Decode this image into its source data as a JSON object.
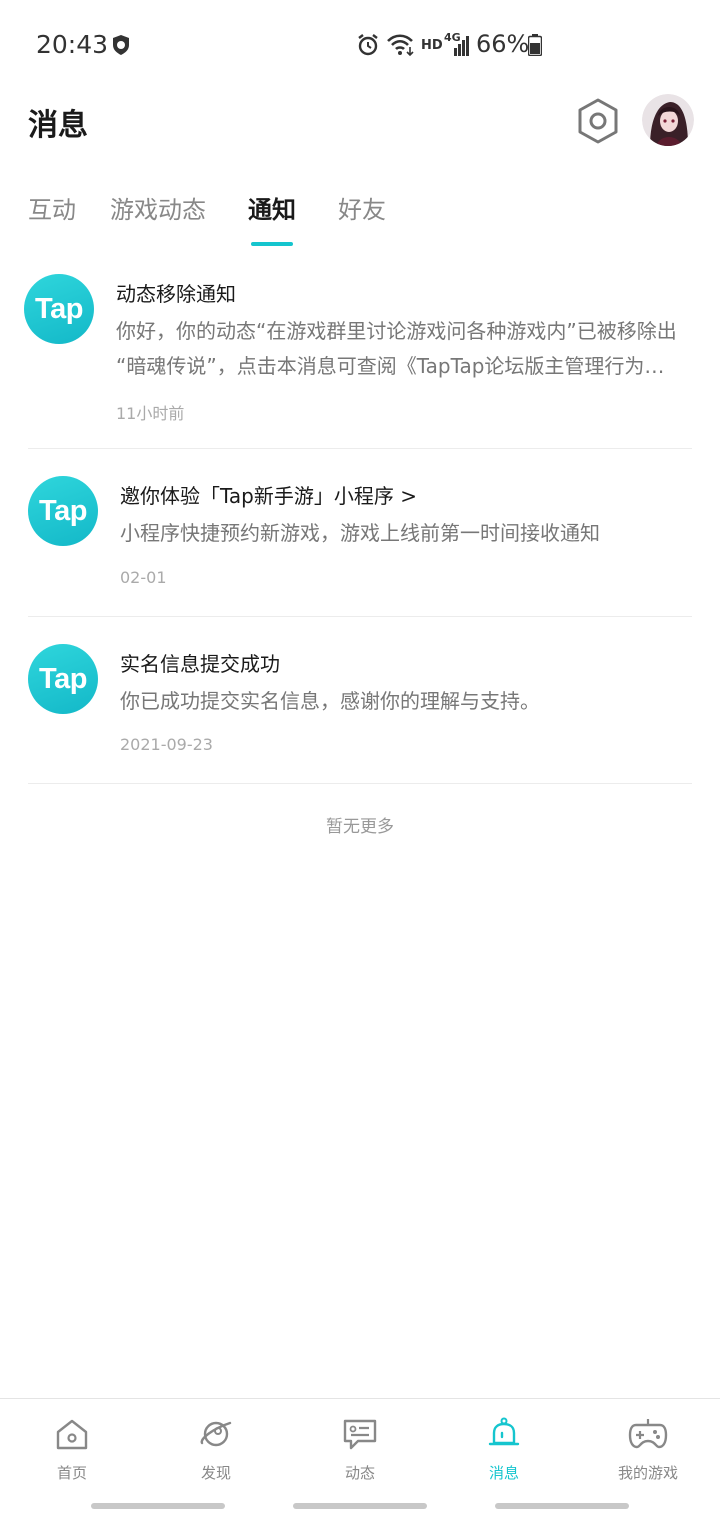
{
  "status_bar": {
    "time": "20:43",
    "network_label": "HD",
    "network_type": "4G",
    "battery": "66%"
  },
  "header": {
    "title": "消息",
    "settings_icon": "hexagon-settings-icon",
    "avatar_icon": "user-avatar"
  },
  "tabs": [
    {
      "label": "互动",
      "active": false
    },
    {
      "label": "游戏动态",
      "active": false
    },
    {
      "label": "通知",
      "active": true
    },
    {
      "label": "好友",
      "active": false
    }
  ],
  "notifications": [
    {
      "logo_text": "Tap",
      "title": "动态移除通知",
      "body_line1": "你好，你的动态“在游戏群里讨论游戏问各种游戏内”已被移除出",
      "body_line2": "“暗魂传说”，点击本消息可查阅《TapTap论坛版主管理行为…",
      "time": "11小时前"
    },
    {
      "logo_text": "Tap",
      "title": "邀你体验「Tap新手游」小程序 >",
      "body_line1": "小程序快捷预约新游戏，游戏上线前第一时间接收通知",
      "time": "02-01"
    },
    {
      "logo_text": "Tap",
      "title": "实名信息提交成功",
      "body_line1": "你已成功提交实名信息，感谢你的理解与支持。",
      "time": "2021-09-23"
    }
  ],
  "no_more_text": "暂无更多",
  "bottom_nav": [
    {
      "label": "首页",
      "icon": "home-icon",
      "active": false
    },
    {
      "label": "发现",
      "icon": "planet-icon",
      "active": false
    },
    {
      "label": "动态",
      "icon": "chat-bubble-icon",
      "active": false
    },
    {
      "label": "消息",
      "icon": "bell-icon",
      "active": true
    },
    {
      "label": "我的游戏",
      "icon": "gamepad-icon",
      "active": false
    }
  ],
  "colors": {
    "accent": "#15c5ce",
    "tap_logo": "#1bc2d0"
  }
}
